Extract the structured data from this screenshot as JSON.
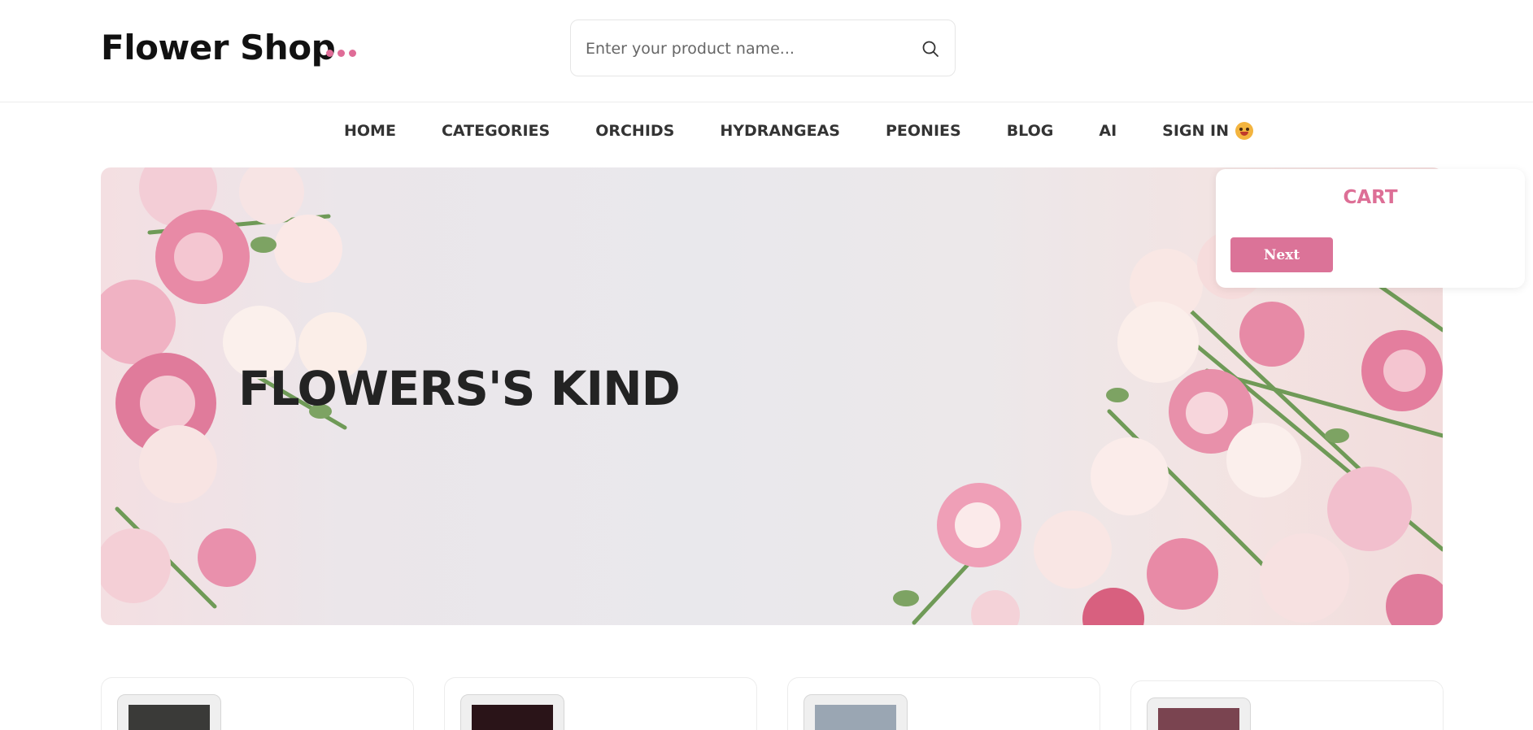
{
  "brand": {
    "name": "Flower Shop",
    "accent": "#df6c97"
  },
  "search": {
    "placeholder": "Enter your product name..."
  },
  "nav": {
    "items": [
      {
        "label": "HOME"
      },
      {
        "label": "CATEGORIES"
      },
      {
        "label": "ORCHIDS"
      },
      {
        "label": "HYDRANGEAS"
      },
      {
        "label": "PEONIES"
      },
      {
        "label": "BLOG"
      },
      {
        "label": "AI"
      },
      {
        "label": "SIGN IN"
      }
    ]
  },
  "hero": {
    "title": "FLOWERS'S KIND"
  },
  "cart": {
    "title": "CART",
    "next_label": "Next"
  },
  "products": [
    {
      "thumb_color": "#3a3a38"
    },
    {
      "thumb_color": "#2a1418"
    },
    {
      "thumb_color": "#9aa6b3"
    },
    {
      "thumb_color": "#7a4450"
    }
  ]
}
